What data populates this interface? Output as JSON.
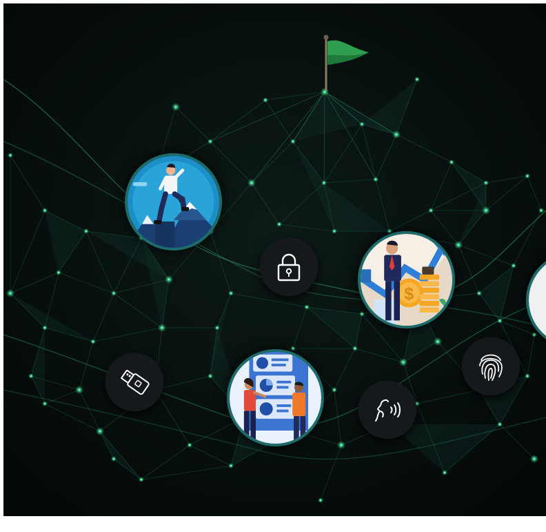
{
  "scene": {
    "background_color": "#07100f",
    "network_color": "#1f8a5c",
    "glow_color": "#2ecf8a",
    "frame_color": "#1d6b6a"
  },
  "items": [
    {
      "id": "flag",
      "icon": "flag-icon",
      "color": "#2e9e4f"
    },
    {
      "id": "mountain-climber",
      "icon": "mountain-climber-illustration"
    },
    {
      "id": "growth",
      "icon": "business-growth-illustration"
    },
    {
      "id": "presentation",
      "icon": "team-presentation-illustration"
    },
    {
      "id": "lock",
      "icon": "lock-icon"
    },
    {
      "id": "usb",
      "icon": "usb-key-icon"
    },
    {
      "id": "voice",
      "icon": "voice-recognition-icon"
    },
    {
      "id": "fingerprint",
      "icon": "fingerprint-icon"
    }
  ]
}
